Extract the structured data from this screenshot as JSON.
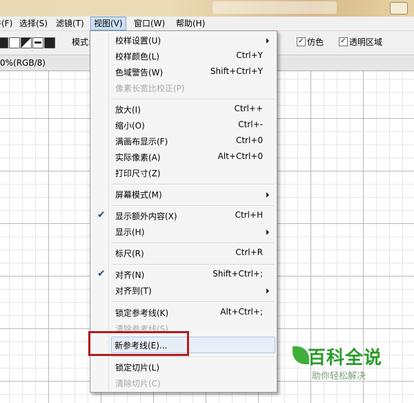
{
  "menubar": {
    "items": [
      {
        "label": "文件(F)"
      },
      {
        "label": "选择(S)"
      },
      {
        "label": "滤镜(T)"
      },
      {
        "label": "视图(V)"
      },
      {
        "label": "窗口(W)"
      },
      {
        "label": "帮助(H)"
      }
    ]
  },
  "toolbar": {
    "mode_label": "模式:",
    "antialias_label": "仿色",
    "transparency_label": "透明区域"
  },
  "document": {
    "title_suffix": "0%(RGB/8)"
  },
  "view_menu": {
    "items": [
      {
        "label": "校样设置(U)",
        "shortcut": "",
        "submenu": true
      },
      {
        "label": "校样颜色(L)",
        "shortcut": "Ctrl+Y"
      },
      {
        "label": "色域警告(W)",
        "shortcut": "Shift+Ctrl+Y"
      },
      {
        "label": "像素长宽比校正(P)",
        "shortcut": "",
        "disabled": true
      },
      {
        "label": "放大(I)",
        "shortcut": "Ctrl++"
      },
      {
        "label": "缩小(O)",
        "shortcut": "Ctrl+-"
      },
      {
        "label": "满画布显示(F)",
        "shortcut": "Ctrl+0"
      },
      {
        "label": "实际像素(A)",
        "shortcut": "Alt+Ctrl+0"
      },
      {
        "label": "打印尺寸(Z)",
        "shortcut": ""
      },
      {
        "label": "屏幕模式(M)",
        "shortcut": "",
        "submenu": true
      },
      {
        "label": "显示额外内容(X)",
        "shortcut": "Ctrl+H",
        "checked": true
      },
      {
        "label": "显示(H)",
        "shortcut": "",
        "submenu": true
      },
      {
        "label": "标尺(R)",
        "shortcut": "Ctrl+R"
      },
      {
        "label": "对齐(N)",
        "shortcut": "Shift+Ctrl+;",
        "checked": true
      },
      {
        "label": "对齐到(T)",
        "shortcut": "",
        "submenu": true
      },
      {
        "label": "锁定参考线(K)",
        "shortcut": "Alt+Ctrl+;"
      },
      {
        "label": "清除参考线(S)",
        "shortcut": "",
        "disabled": true
      },
      {
        "label": "新参考线(E)...",
        "shortcut": "",
        "highlighted": true
      },
      {
        "label": "锁定切片(L)",
        "shortcut": ""
      },
      {
        "label": "清除切片(C)",
        "shortcut": "",
        "disabled": true
      }
    ]
  },
  "icons": {
    "check": "check-icon",
    "submenu_arrow": "chevron-right-icon"
  },
  "colors": {
    "highlight_border": "#b01c1c",
    "watermark_green": "#2a9b2a"
  },
  "watermark": {
    "title": "百科全说",
    "subtitle": "助你轻松解决"
  }
}
